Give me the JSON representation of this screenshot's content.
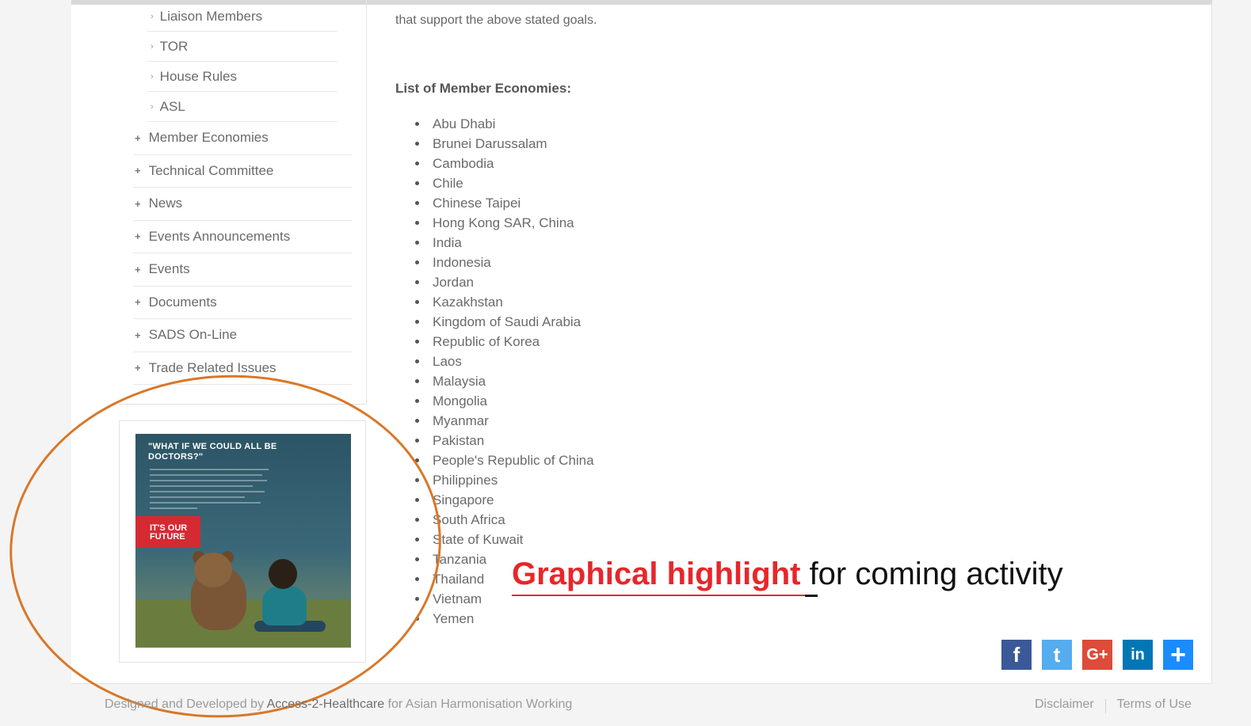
{
  "intro": {
    "trailing_text": "that support the above stated goals."
  },
  "sidebar": {
    "sub_items": [
      {
        "label": "Liaison Members"
      },
      {
        "label": "TOR"
      },
      {
        "label": "House Rules"
      },
      {
        "label": "ASL"
      }
    ],
    "items": [
      {
        "label": "Member Economies"
      },
      {
        "label": "Technical Committee"
      },
      {
        "label": "News"
      },
      {
        "label": "Events Announcements"
      },
      {
        "label": "Events"
      },
      {
        "label": "Documents"
      },
      {
        "label": "SADS On-Line"
      },
      {
        "label": "Trade Related Issues"
      }
    ]
  },
  "ad": {
    "headline": "\"WHAT IF WE COULD ALL BE DOCTORS?\"",
    "badge": "IT'S OUR FUTURE"
  },
  "member_list": {
    "heading": "List of Member Economies:",
    "economies": [
      "Abu Dhabi",
      "Brunei Darussalam",
      "Cambodia",
      "Chile",
      "Chinese Taipei",
      "Hong Kong SAR, China",
      "India",
      "Indonesia",
      "Jordan",
      "Kazakhstan",
      "Kingdom of Saudi Arabia",
      "Republic of Korea",
      "Laos",
      "Malaysia",
      "Mongolia",
      "Myanmar",
      "Pakistan",
      "People's Republic of China",
      "Philippines",
      "Singapore",
      "South Africa",
      "State of Kuwait",
      "Tanzania",
      "Thailand",
      "Vietnam",
      "Yemen"
    ]
  },
  "annotation": {
    "highlight": "Graphical highlight",
    "rest": " for coming activity",
    "highlight_color": "#e8262a",
    "ellipse_color": "#d97728"
  },
  "share": [
    {
      "icon": "facebook-icon",
      "glyph": "f",
      "color": "#3b5998"
    },
    {
      "icon": "twitter-icon",
      "glyph": "t",
      "color": "#55acee"
    },
    {
      "icon": "google-plus-icon",
      "glyph": "G+",
      "color": "#dd4b39"
    },
    {
      "icon": "linkedin-icon",
      "glyph": "in",
      "color": "#0077b5"
    },
    {
      "icon": "add-share-icon",
      "glyph": "+",
      "color": "#1a8cff"
    }
  ],
  "footer": {
    "prefix": "Designed and Developed by ",
    "brand": "Access-2-Healthcare",
    "suffix": " for Asian Harmonisation Working",
    "disclaimer": "Disclaimer",
    "terms": "Terms of Use"
  }
}
